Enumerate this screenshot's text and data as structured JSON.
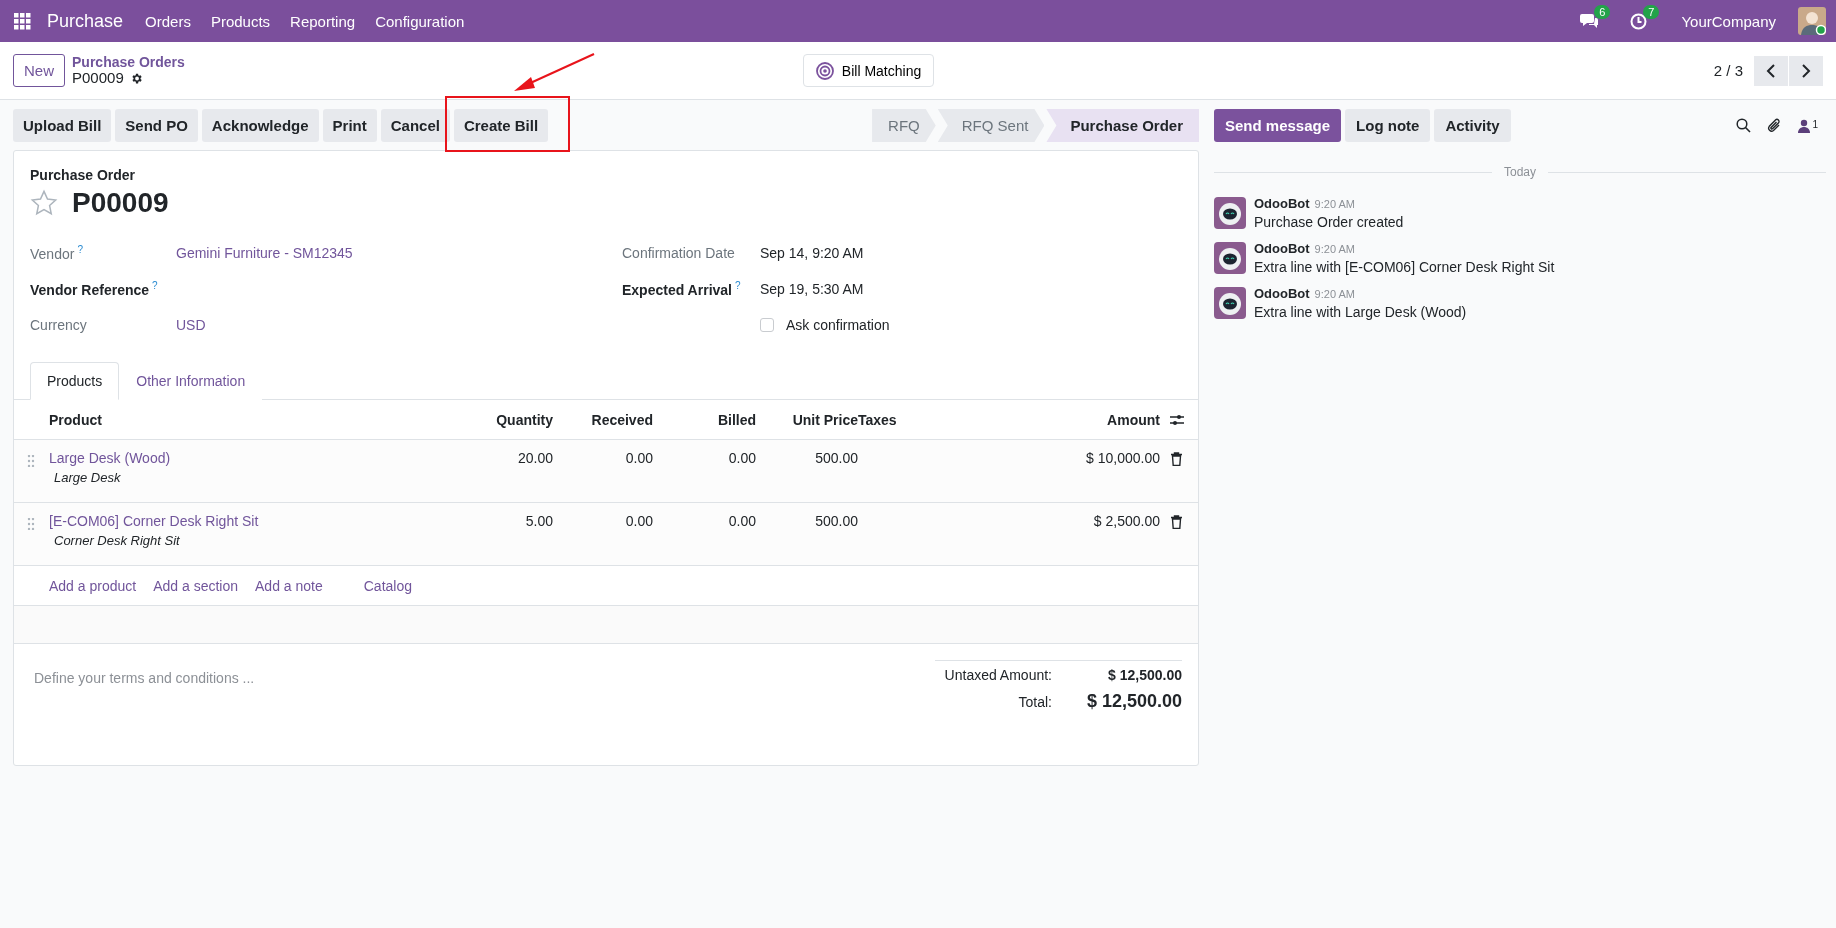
{
  "navbar": {
    "app": "Purchase",
    "menu": [
      "Orders",
      "Products",
      "Reporting",
      "Configuration"
    ],
    "messages_badge": "6",
    "activities_badge": "7",
    "company": "YourCompany",
    "online": true
  },
  "control_panel": {
    "new_button": "New",
    "breadcrumb": "Purchase Orders",
    "record": "P00009",
    "smart_button": "Bill Matching",
    "pager": "2 / 3"
  },
  "actions": [
    {
      "label": "Upload Bill",
      "highlighted": false
    },
    {
      "label": "Send PO",
      "highlighted": false
    },
    {
      "label": "Acknowledge",
      "highlighted": false
    },
    {
      "label": "Print",
      "highlighted": false
    },
    {
      "label": "Cancel",
      "highlighted": false
    },
    {
      "label": "Create Bill",
      "highlighted": true
    }
  ],
  "statusbar": [
    {
      "label": "RFQ",
      "selected": false
    },
    {
      "label": "RFQ Sent",
      "selected": false
    },
    {
      "label": "Purchase Order",
      "selected": true
    }
  ],
  "form": {
    "title_label": "Purchase Order",
    "name": "P00009",
    "starred": false,
    "fields_left": [
      {
        "label": "Vendor",
        "help": "?",
        "required": false,
        "kind": "link",
        "value": "Gemini Furniture - SM12345"
      },
      {
        "label": "Vendor Reference",
        "help": "?",
        "required": true,
        "kind": "empty"
      },
      {
        "label": "Currency",
        "required": false,
        "kind": "link",
        "value": "USD"
      }
    ],
    "fields_right": [
      {
        "label": "Confirmation Date",
        "required": false,
        "kind": "text",
        "value": "Sep 14, 9:20 AM"
      },
      {
        "label": "Expected Arrival",
        "help": "?",
        "required": true,
        "kind": "text",
        "value": "Sep 19, 5:30 AM"
      },
      {
        "kind": "checkbox",
        "checked": false,
        "value": "Ask confirmation"
      }
    ]
  },
  "tabs": [
    {
      "label": "Products",
      "selected": true
    },
    {
      "label": "Other Information",
      "selected": false
    }
  ],
  "table": {
    "columns": [
      "Product",
      "Quantity",
      "Received",
      "Billed",
      "Unit Price",
      "Taxes",
      "Amount"
    ],
    "rows": [
      {
        "cells": [
          "Large Desk (Wood)",
          "20.00",
          "0.00",
          "0.00",
          "500.00",
          "",
          "$ 10,000.00"
        ],
        "description": "Large Desk"
      },
      {
        "cells": [
          "[E-COM06] Corner Desk Right Sit",
          "5.00",
          "0.00",
          "0.00",
          "500.00",
          "",
          "$ 2,500.00"
        ],
        "description": "Corner Desk Right Sit"
      }
    ],
    "add_links": [
      "Add a product",
      "Add a section",
      "Add a note",
      "Catalog"
    ]
  },
  "terms": {
    "placeholder": "Define your terms and conditions ..."
  },
  "totals": {
    "untaxed_label": "Untaxed Amount:",
    "untaxed_value": "$ 12,500.00",
    "total_label": "Total:",
    "total_value": "$ 12,500.00"
  },
  "chatter": {
    "buttons": [
      {
        "label": "Send message",
        "primary": true
      },
      {
        "label": "Log note",
        "primary": false
      },
      {
        "label": "Activity",
        "primary": false
      }
    ],
    "followers_count": "1",
    "date_separator": "Today",
    "messages": [
      {
        "author": "OdooBot",
        "time": "9:20 AM",
        "body": "Purchase Order created"
      },
      {
        "author": "OdooBot",
        "time": "9:20 AM",
        "body": "Extra line with [E-COM06] Corner Desk Right Sit"
      },
      {
        "author": "OdooBot",
        "time": "9:20 AM",
        "body": "Extra line with Large Desk (Wood)"
      }
    ]
  }
}
